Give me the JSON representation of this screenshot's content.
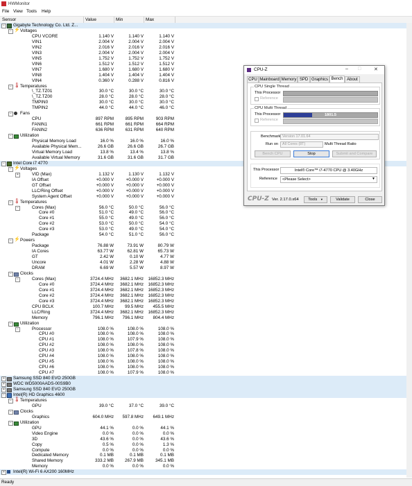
{
  "window": {
    "title": "HWMonitor"
  },
  "menu": [
    "File",
    "View",
    "Tools",
    "Help"
  ],
  "columns": [
    "Sensor",
    "Value",
    "Min",
    "Max"
  ],
  "status": "Ready",
  "tree": [
    {
      "name": "Gigabyte Technology Co. Ltd. Z...",
      "level": 0,
      "icon": "motherboard-icon",
      "exp": "minus",
      "hl": true
    },
    {
      "name": "Voltages",
      "level": 1,
      "icon": "voltage-icon",
      "exp": "minus"
    },
    {
      "name": "CPU VCORE",
      "level": 2,
      "v": "1.140 V",
      "mn": "1.140 V",
      "mx": "1.140 V"
    },
    {
      "name": "VIN1",
      "level": 2,
      "v": "2.004 V",
      "mn": "2.004 V",
      "mx": "2.004 V"
    },
    {
      "name": "VIN2",
      "level": 2,
      "v": "2.016 V",
      "mn": "2.016 V",
      "mx": "2.016 V"
    },
    {
      "name": "VIN3",
      "level": 2,
      "v": "2.004 V",
      "mn": "2.004 V",
      "mx": "2.004 V"
    },
    {
      "name": "VIN5",
      "level": 2,
      "v": "1.752 V",
      "mn": "1.752 V",
      "mx": "1.752 V"
    },
    {
      "name": "VIN6",
      "level": 2,
      "v": "1.512 V",
      "mn": "1.512 V",
      "mx": "1.512 V"
    },
    {
      "name": "VIN7",
      "level": 2,
      "v": "1.680 V",
      "mn": "1.680 V",
      "mx": "1.680 V"
    },
    {
      "name": "VIN8",
      "level": 2,
      "v": "1.404 V",
      "mn": "1.404 V",
      "mx": "1.404 V"
    },
    {
      "name": "VIN4",
      "level": 2,
      "v": "0.360 V",
      "mn": "0.288 V",
      "mx": "0.816 V"
    },
    {
      "name": "Temperatures",
      "level": 1,
      "icon": "temperature-icon",
      "exp": "minus"
    },
    {
      "name": "\\_TZ.TZ01",
      "level": 2,
      "v": "30.0 °C",
      "mn": "30.0 °C",
      "mx": "30.0 °C"
    },
    {
      "name": "\\_TZ.TZ00",
      "level": 2,
      "v": "28.0 °C",
      "mn": "28.0 °C",
      "mx": "28.0 °C"
    },
    {
      "name": "TMPIN0",
      "level": 2,
      "v": "30.0 °C",
      "mn": "30.0 °C",
      "mx": "30.0 °C"
    },
    {
      "name": "TMPIN2",
      "level": 2,
      "v": "44.0 °C",
      "mn": "44.0 °C",
      "mx": "46.0 °C"
    },
    {
      "name": "Fans",
      "level": 1,
      "icon": "fan-icon",
      "exp": "minus"
    },
    {
      "name": "CPU",
      "level": 2,
      "v": "897 RPM",
      "mn": "895 RPM",
      "mx": "903 RPM"
    },
    {
      "name": "FANIN1",
      "level": 2,
      "v": "661 RPM",
      "mn": "661 RPM",
      "mx": "664 RPM"
    },
    {
      "name": "FANIN2",
      "level": 2,
      "v": "636 RPM",
      "mn": "631 RPM",
      "mx": "640 RPM"
    },
    {
      "name": "Utilization",
      "level": 1,
      "icon": "utilization-icon",
      "exp": "minus"
    },
    {
      "name": "Physical Memory Load",
      "level": 2,
      "v": "16.0 %",
      "mn": "16.0 %",
      "mx": "16.0 %"
    },
    {
      "name": "Available Physical Mem...",
      "level": 2,
      "v": "26.6 GB",
      "mn": "26.6 GB",
      "mx": "26.7 GB"
    },
    {
      "name": "Virtual Memory Load",
      "level": 2,
      "v": "13.8 %",
      "mn": "13.4 %",
      "mx": "13.8 %"
    },
    {
      "name": "Available Virtual Memory",
      "level": 2,
      "v": "31.6 GB",
      "mn": "31.6 GB",
      "mx": "31.7 GB"
    },
    {
      "name": "Intel Core i7 4770",
      "level": 0,
      "icon": "cpu-icon",
      "exp": "minus",
      "hl": true
    },
    {
      "name": "Voltages",
      "level": 1,
      "icon": "voltage-icon",
      "exp": "minus"
    },
    {
      "name": "VID (Max)",
      "level": 2,
      "exp": "plus",
      "v": "1.132 V",
      "mn": "1.130 V",
      "mx": "1.132 V"
    },
    {
      "name": "IA Offset",
      "level": 2,
      "v": "+0.000 V",
      "mn": "+0.000 V",
      "mx": "+0.000 V"
    },
    {
      "name": "GT Offset",
      "level": 2,
      "v": "+0.000 V",
      "mn": "+0.000 V",
      "mx": "+0.000 V"
    },
    {
      "name": "LLC/Ring Offset",
      "level": 2,
      "v": "+0.000 V",
      "mn": "+0.000 V",
      "mx": "+0.000 V"
    },
    {
      "name": "System Agent Offset",
      "level": 2,
      "v": "+0.000 V",
      "mn": "+0.000 V",
      "mx": "+0.000 V"
    },
    {
      "name": "Temperatures",
      "level": 1,
      "icon": "temperature-icon",
      "exp": "minus"
    },
    {
      "name": "Cores (Max)",
      "level": 2,
      "exp": "minus",
      "v": "56.0 °C",
      "mn": "50.0 °C",
      "mx": "56.0 °C"
    },
    {
      "name": "Core #0",
      "level": 3,
      "v": "51.0 °C",
      "mn": "49.0 °C",
      "mx": "56.0 °C"
    },
    {
      "name": "Core #1",
      "level": 3,
      "v": "55.0 °C",
      "mn": "49.0 °C",
      "mx": "56.0 °C"
    },
    {
      "name": "Core #2",
      "level": 3,
      "v": "53.0 °C",
      "mn": "50.0 °C",
      "mx": "54.0 °C"
    },
    {
      "name": "Core #3",
      "level": 3,
      "v": "53.0 °C",
      "mn": "49.0 °C",
      "mx": "54.0 °C"
    },
    {
      "name": "Package",
      "level": 2,
      "v": "54.0 °C",
      "mn": "51.0 °C",
      "mx": "56.0 °C"
    },
    {
      "name": "Powers",
      "level": 1,
      "icon": "power-icon",
      "exp": "minus"
    },
    {
      "name": "Package",
      "level": 2,
      "v": "76.88 W",
      "mn": "73.91 W",
      "mx": "80.79 W"
    },
    {
      "name": "IA Cores",
      "level": 2,
      "v": "63.77 W",
      "mn": "62.81 W",
      "mx": "65.73 W"
    },
    {
      "name": "GT",
      "level": 2,
      "v": "2.42 W",
      "mn": "0.10 W",
      "mx": "4.77 W"
    },
    {
      "name": "Uncore",
      "level": 2,
      "v": "4.01 W",
      "mn": "2.28 W",
      "mx": "4.88 W"
    },
    {
      "name": "DRAM",
      "level": 2,
      "v": "6.69 W",
      "mn": "5.57 W",
      "mx": "8.97 W"
    },
    {
      "name": "Clocks",
      "level": 1,
      "icon": "clock-icon",
      "exp": "minus"
    },
    {
      "name": "Cores (Max)",
      "level": 2,
      "exp": "minus",
      "v": "3724.4 MHz",
      "mn": "3682.1 MHz",
      "mx": "16852.3 MHz"
    },
    {
      "name": "Core #0",
      "level": 3,
      "v": "3724.4 MHz",
      "mn": "3682.1 MHz",
      "mx": "16852.3 MHz"
    },
    {
      "name": "Core #1",
      "level": 3,
      "v": "3724.4 MHz",
      "mn": "3682.1 MHz",
      "mx": "16852.3 MHz"
    },
    {
      "name": "Core #2",
      "level": 3,
      "v": "3724.4 MHz",
      "mn": "3682.1 MHz",
      "mx": "16852.3 MHz"
    },
    {
      "name": "Core #3",
      "level": 3,
      "v": "3724.4 MHz",
      "mn": "3682.1 MHz",
      "mx": "16852.3 MHz"
    },
    {
      "name": "CPU BCLK",
      "level": 2,
      "v": "100.7 MHz",
      "mn": "99.5 MHz",
      "mx": "455.5 MHz"
    },
    {
      "name": "LLC/Ring",
      "level": 2,
      "v": "3724.4 MHz",
      "mn": "3682.1 MHz",
      "mx": "16852.3 MHz"
    },
    {
      "name": "Memory",
      "level": 2,
      "v": "796.1 MHz",
      "mn": "796.1 MHz",
      "mx": "804.4 MHz"
    },
    {
      "name": "Utilization",
      "level": 1,
      "icon": "utilization-icon",
      "exp": "minus"
    },
    {
      "name": "Processor",
      "level": 2,
      "exp": "minus",
      "v": "108.0 %",
      "mn": "108.0 %",
      "mx": "108.0 %"
    },
    {
      "name": "CPU #0",
      "level": 3,
      "v": "108.0 %",
      "mn": "108.0 %",
      "mx": "108.0 %"
    },
    {
      "name": "CPU #1",
      "level": 3,
      "v": "108.0 %",
      "mn": "107.9 %",
      "mx": "108.0 %"
    },
    {
      "name": "CPU #2",
      "level": 3,
      "v": "108.0 %",
      "mn": "108.0 %",
      "mx": "108.0 %"
    },
    {
      "name": "CPU #3",
      "level": 3,
      "v": "108.0 %",
      "mn": "107.8 %",
      "mx": "108.0 %"
    },
    {
      "name": "CPU #4",
      "level": 3,
      "v": "108.0 %",
      "mn": "108.0 %",
      "mx": "108.0 %"
    },
    {
      "name": "CPU #5",
      "level": 3,
      "v": "108.0 %",
      "mn": "108.0 %",
      "mx": "108.0 %"
    },
    {
      "name": "CPU #6",
      "level": 3,
      "v": "108.0 %",
      "mn": "108.0 %",
      "mx": "108.0 %"
    },
    {
      "name": "CPU #7",
      "level": 3,
      "v": "108.0 %",
      "mn": "107.9 %",
      "mx": "108.0 %"
    },
    {
      "name": "Samsung SSD 840 EVO 250GB",
      "level": 0,
      "icon": "disk-icon",
      "exp": "plus",
      "hl": true
    },
    {
      "name": "WDC WD5000AADS-00S9B0",
      "level": 0,
      "icon": "disk-icon",
      "exp": "plus",
      "hl": true
    },
    {
      "name": "Samsung SSD 840 EVO 250GB",
      "level": 0,
      "icon": "disk-icon",
      "exp": "plus",
      "hl": true
    },
    {
      "name": "Intel(R) HD Graphics 4600",
      "level": 0,
      "icon": "gpu-icon",
      "exp": "minus",
      "hl": true
    },
    {
      "name": "Temperatures",
      "level": 1,
      "icon": "temperature-icon",
      "exp": "minus"
    },
    {
      "name": "GPU",
      "level": 2,
      "v": "39.0 °C",
      "mn": "37.0 °C",
      "mx": "39.0 °C"
    },
    {
      "name": "Clocks",
      "level": 1,
      "icon": "clock-icon",
      "exp": "minus"
    },
    {
      "name": "Graphics",
      "level": 2,
      "v": "604.0 MHz",
      "mn": "597.8 MHz",
      "mx": "649.1 MHz"
    },
    {
      "name": "Utilization",
      "level": 1,
      "icon": "utilization-icon",
      "exp": "minus"
    },
    {
      "name": "GPU",
      "level": 2,
      "v": "44.1 %",
      "mn": "0.0 %",
      "mx": "44.1 %"
    },
    {
      "name": "Video Engine",
      "level": 2,
      "v": "0.0 %",
      "mn": "0.0 %",
      "mx": "0.0 %"
    },
    {
      "name": "3D",
      "level": 2,
      "v": "43.6 %",
      "mn": "0.0 %",
      "mx": "43.6 %"
    },
    {
      "name": "Copy",
      "level": 2,
      "v": "0.5 %",
      "mn": "0.0 %",
      "mx": "1.3 %"
    },
    {
      "name": "Compute",
      "level": 2,
      "v": "0.0 %",
      "mn": "0.0 %",
      "mx": "0.0 %"
    },
    {
      "name": "Dedicated Memory",
      "level": 2,
      "v": "0.1 MB",
      "mn": "0.1 MB",
      "mx": "0.1 MB"
    },
    {
      "name": "Shared Memory",
      "level": 2,
      "v": "333.2 MB",
      "mn": "267.9 MB",
      "mx": "345.1 MB"
    },
    {
      "name": "Memory",
      "level": 2,
      "v": "0.0 %",
      "mn": "0.0 %",
      "mx": "0.0 %"
    },
    {
      "name": "Intel(R) Wi-Fi 6 AX200 160MHz",
      "level": 0,
      "icon": "wifi-icon",
      "exp": "plus",
      "hl": true
    }
  ],
  "cpuz": {
    "title": "CPU-Z",
    "tabs": [
      "CPU",
      "Mainboard",
      "Memory",
      "SPD",
      "Graphics",
      "Bench",
      "About"
    ],
    "active_tab": "Bench",
    "single_thread": {
      "label": "CPU Single Thread",
      "this_processor": "This Processor",
      "reference": "Reference"
    },
    "multi_thread": {
      "label": "CPU Multi Thread",
      "this_processor": "This Processor",
      "reference": "Reference",
      "score": "1801.5",
      "progress": 0.3
    },
    "benchmark_label": "Benchmark",
    "benchmark_value": "Version 17.01.64",
    "run_on_label": "Run on",
    "run_on_value": "All Cores (8T)",
    "ratio_label": "Multi Thread Ratio",
    "btn_bench": "Bench CPU",
    "btn_stop": "Stop",
    "btn_submit": "Submit and Compare",
    "processor_label": "This Processor",
    "processor_value": "Intel® Core™ i7-4770 CPU @ 3.40GHz",
    "reference_label": "Reference",
    "reference_value": "<Please Select>",
    "logo": "CPU-Z",
    "version": "Ver. 2.17.0.x64",
    "btn_tools": "Tools",
    "btn_validate": "Validate",
    "btn_close": "Close"
  }
}
